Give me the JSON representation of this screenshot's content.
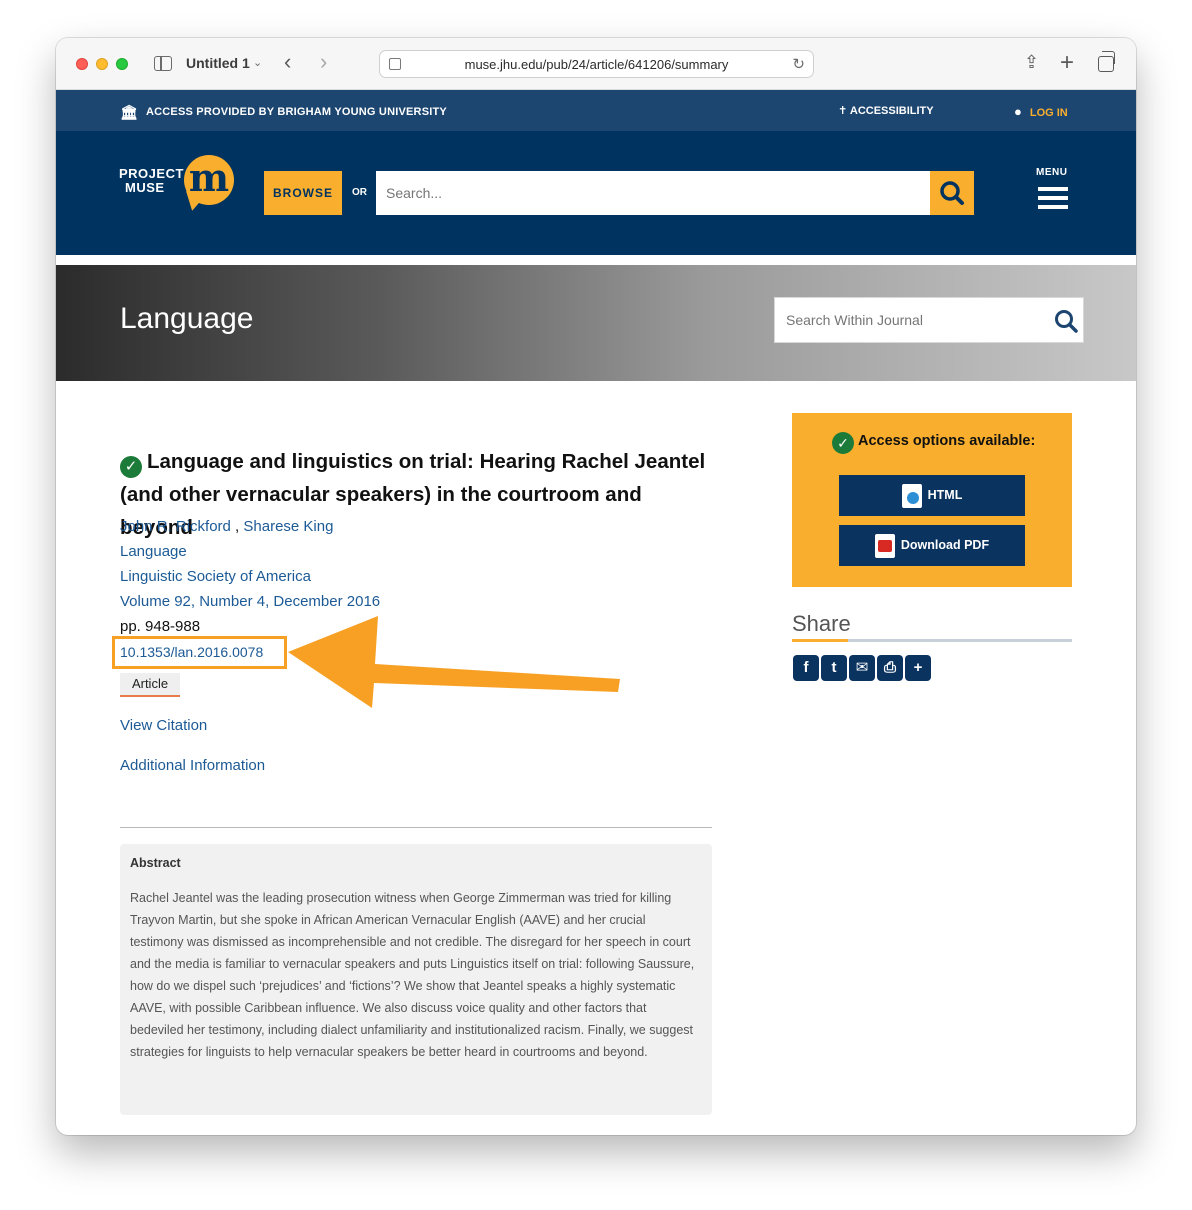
{
  "browser": {
    "tab_title": "Untitled 1",
    "url": "muse.jhu.edu/pub/24/article/641206/summary"
  },
  "top_bar": {
    "access_text": "ACCESS PROVIDED BY BRIGHAM YOUNG UNIVERSITY",
    "accessibility_label": "ACCESSIBILITY",
    "login_label": "LOG IN"
  },
  "header": {
    "logo_line1": "PROJECT",
    "logo_line2": "MUSE",
    "logo_mark": "m",
    "browse_label": "BROWSE",
    "or_label": "OR",
    "search_placeholder": "Search...",
    "menu_label": "MENU"
  },
  "journal": {
    "title": "Language",
    "search_placeholder": "Search Within Journal"
  },
  "article": {
    "title": "Language and linguistics on trial: Hearing Rachel Jeantel (and other vernacular speakers) in the courtroom and beyond",
    "authors": [
      "John R. Rickford",
      "Sharese King"
    ],
    "author_separator": " , ",
    "journal_link": "Language",
    "publisher": "Linguistic Society of America",
    "issue": "Volume 92, Number 4, December 2016",
    "pages": "pp. 948-988",
    "doi": "10.1353/lan.2016.0078",
    "type_tag": "Article",
    "view_citation": "View Citation",
    "additional_info": "Additional Information",
    "abstract_heading": "Abstract",
    "abstract_text": "Rachel Jeantel was the leading prosecution witness when George Zimmerman was tried for killing Trayvon Martin, but she spoke in African American Vernacular English (AAVE) and her crucial testimony was dismissed as incomprehensible and not credible. The disregard for her speech in court and the media is familiar to vernacular speakers and puts Linguistics itself on trial: following Saussure, how do we dispel such ‘prejudices’ and ‘fictions’? We show that Jeantel speaks a highly systematic AAVE, with possible Caribbean influence. We also discuss voice quality and other factors that bedeviled her testimony, including dialect unfamiliarity and institutionalized racism. Finally, we suggest strategies for linguists to help vernacular speakers be better heard in courtrooms and beyond."
  },
  "sidebar": {
    "access_heading": "Access options available:",
    "html_label": "HTML",
    "pdf_label": "Download PDF",
    "share_heading": "Share",
    "share_icons": [
      "facebook-icon",
      "twitter-icon",
      "email-icon",
      "print-icon",
      "more-share-icon"
    ]
  },
  "colors": {
    "brand_navy": "#003360",
    "access_bar": "#1c4670",
    "brand_gold": "#f9af2d",
    "link_blue": "#1c5a96",
    "annotation_orange": "#f7a024",
    "check_green": "#1d7b3a"
  }
}
